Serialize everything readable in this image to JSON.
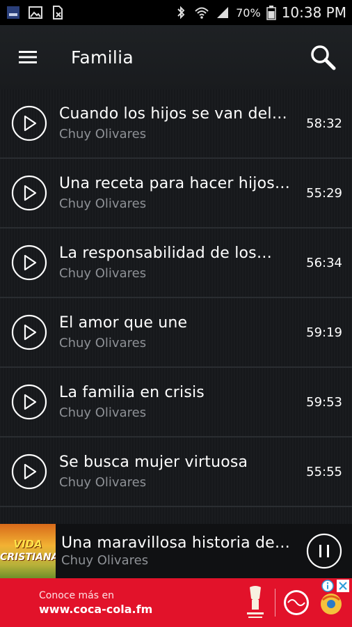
{
  "status_bar": {
    "battery": "70%",
    "time": "10:38 PM"
  },
  "app_bar": {
    "title": "Familia"
  },
  "list": [
    {
      "title": "Cuando los hijos se van del…",
      "artist": "Chuy Olivares",
      "duration": "58:32"
    },
    {
      "title": "Una receta para hacer hijos…",
      "artist": "Chuy Olivares",
      "duration": "55:29"
    },
    {
      "title": "La responsabilidad de los…",
      "artist": "Chuy Olivares",
      "duration": "56:34"
    },
    {
      "title": "El amor que une",
      "artist": "Chuy Olivares",
      "duration": "59:19"
    },
    {
      "title": "La familia en crisis",
      "artist": "Chuy Olivares",
      "duration": "59:53"
    },
    {
      "title": "Se busca mujer virtuosa",
      "artist": "Chuy Olivares",
      "duration": "55:55"
    }
  ],
  "now_playing": {
    "title": "Una maravillosa historia de…",
    "artist": "Chuy Olivares",
    "art_line1": "VIDA",
    "art_line2": "CRISTIANA"
  },
  "ad": {
    "line1": "Conoce más en",
    "line2": "www.coca-cola.fm",
    "background_color": "#e2122a"
  },
  "icons": {
    "menu": "menu-icon",
    "search": "search-icon",
    "play": "play-circle-icon",
    "pause": "pause-circle-icon",
    "bluetooth": "bluetooth-icon",
    "wifi": "wifi-icon",
    "signal": "signal-icon",
    "battery": "battery-icon"
  }
}
